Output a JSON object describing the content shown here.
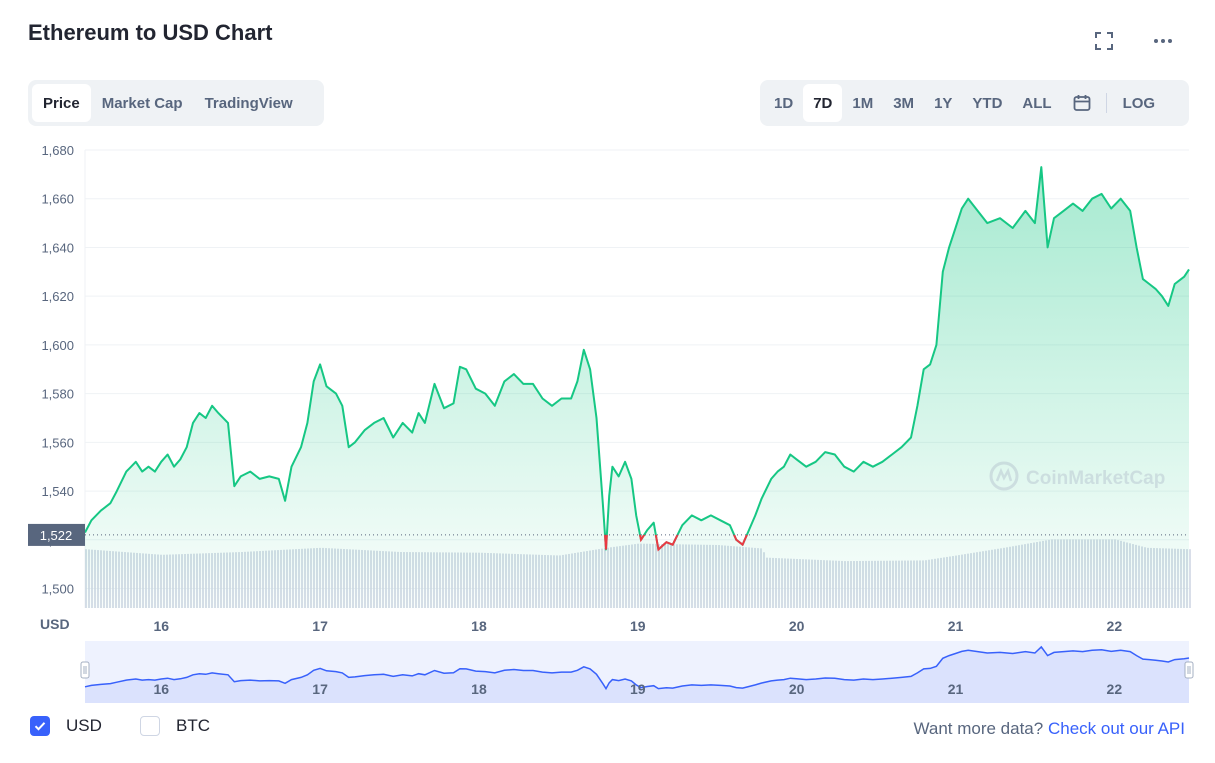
{
  "header": {
    "title": "Ethereum to USD Chart",
    "fullscreen_icon": "fullscreen-icon",
    "more_icon": "more-icon"
  },
  "tabs": [
    {
      "label": "Price",
      "active": true
    },
    {
      "label": "Market Cap",
      "active": false
    },
    {
      "label": "TradingView",
      "active": false
    }
  ],
  "ranges": [
    {
      "label": "1D",
      "active": false
    },
    {
      "label": "7D",
      "active": true
    },
    {
      "label": "1M",
      "active": false
    },
    {
      "label": "3M",
      "active": false
    },
    {
      "label": "1Y",
      "active": false
    },
    {
      "label": "YTD",
      "active": false
    },
    {
      "label": "ALL",
      "active": false
    }
  ],
  "calendar_icon": "calendar-icon",
  "log_label": "LOG",
  "currency": {
    "usd": {
      "label": "USD",
      "checked": true
    },
    "btc": {
      "label": "BTC",
      "checked": false
    }
  },
  "footer": {
    "text": "Want more data?",
    "link": "Check out our API"
  },
  "watermark": "CoinMarketCap",
  "colors": {
    "up": "#16c784",
    "down": "#ea3943",
    "accent": "#3861fb",
    "nav_line": "#3861fb"
  },
  "chart_data": {
    "type": "line",
    "xlabel": "",
    "ylabel": "USD",
    "x_ticks": [
      "16",
      "17",
      "18",
      "19",
      "20",
      "21",
      "22"
    ],
    "x_tick_positions": [
      16,
      17,
      18,
      19,
      20,
      21,
      22
    ],
    "x_range": [
      15.52,
      22.47
    ],
    "y_ticks": [
      1500,
      1520,
      1540,
      1560,
      1580,
      1600,
      1620,
      1640,
      1660,
      1680
    ],
    "y_range": [
      1492,
      1680
    ],
    "reference_price": 1522,
    "reference_label": "1,522",
    "grid": true,
    "series": [
      {
        "values": [
          [
            15.52,
            1523
          ],
          [
            15.56,
            1528
          ],
          [
            15.62,
            1532
          ],
          [
            15.68,
            1535
          ],
          [
            15.72,
            1540
          ],
          [
            15.78,
            1548
          ],
          [
            15.84,
            1552
          ],
          [
            15.88,
            1548
          ],
          [
            15.92,
            1550
          ],
          [
            15.96,
            1548
          ],
          [
            16.0,
            1552
          ],
          [
            16.04,
            1555
          ],
          [
            16.08,
            1550
          ],
          [
            16.12,
            1553
          ],
          [
            16.16,
            1558
          ],
          [
            16.2,
            1568
          ],
          [
            16.24,
            1572
          ],
          [
            16.28,
            1570
          ],
          [
            16.32,
            1575
          ],
          [
            16.36,
            1572
          ],
          [
            16.42,
            1568
          ],
          [
            16.46,
            1542
          ],
          [
            16.5,
            1546
          ],
          [
            16.56,
            1548
          ],
          [
            16.62,
            1545
          ],
          [
            16.68,
            1546
          ],
          [
            16.74,
            1545
          ],
          [
            16.78,
            1536
          ],
          [
            16.82,
            1550
          ],
          [
            16.88,
            1558
          ],
          [
            16.92,
            1568
          ],
          [
            16.96,
            1585
          ],
          [
            17.0,
            1592
          ],
          [
            17.04,
            1583
          ],
          [
            17.1,
            1580
          ],
          [
            17.14,
            1575
          ],
          [
            17.18,
            1558
          ],
          [
            17.22,
            1560
          ],
          [
            17.28,
            1565
          ],
          [
            17.34,
            1568
          ],
          [
            17.4,
            1570
          ],
          [
            17.46,
            1562
          ],
          [
            17.52,
            1568
          ],
          [
            17.58,
            1564
          ],
          [
            17.62,
            1572
          ],
          [
            17.66,
            1568
          ],
          [
            17.72,
            1584
          ],
          [
            17.78,
            1574
          ],
          [
            17.84,
            1576
          ],
          [
            17.88,
            1591
          ],
          [
            17.92,
            1590
          ],
          [
            17.98,
            1582
          ],
          [
            18.04,
            1580
          ],
          [
            18.1,
            1575
          ],
          [
            18.16,
            1585
          ],
          [
            18.22,
            1588
          ],
          [
            18.28,
            1584
          ],
          [
            18.34,
            1584
          ],
          [
            18.4,
            1578
          ],
          [
            18.46,
            1575
          ],
          [
            18.52,
            1578
          ],
          [
            18.58,
            1578
          ],
          [
            18.62,
            1585
          ],
          [
            18.66,
            1598
          ],
          [
            18.7,
            1590
          ],
          [
            18.74,
            1570
          ],
          [
            18.78,
            1535
          ],
          [
            18.8,
            1516
          ],
          [
            18.82,
            1538
          ],
          [
            18.84,
            1550
          ],
          [
            18.88,
            1546
          ],
          [
            18.92,
            1552
          ],
          [
            18.96,
            1545
          ],
          [
            18.99,
            1530
          ],
          [
            19.02,
            1520
          ],
          [
            19.06,
            1524
          ],
          [
            19.1,
            1527
          ],
          [
            19.13,
            1516
          ],
          [
            19.18,
            1519
          ],
          [
            19.22,
            1518
          ],
          [
            19.28,
            1526
          ],
          [
            19.34,
            1530
          ],
          [
            19.4,
            1528
          ],
          [
            19.46,
            1530
          ],
          [
            19.52,
            1528
          ],
          [
            19.58,
            1526
          ],
          [
            19.62,
            1520
          ],
          [
            19.66,
            1518
          ],
          [
            19.7,
            1524
          ],
          [
            19.74,
            1530
          ],
          [
            19.78,
            1537
          ],
          [
            19.84,
            1545
          ],
          [
            19.88,
            1548
          ],
          [
            19.92,
            1550
          ],
          [
            19.96,
            1555
          ],
          [
            20.0,
            1553
          ],
          [
            20.06,
            1550
          ],
          [
            20.12,
            1552
          ],
          [
            20.18,
            1556
          ],
          [
            20.24,
            1555
          ],
          [
            20.3,
            1550
          ],
          [
            20.36,
            1548
          ],
          [
            20.42,
            1552
          ],
          [
            20.48,
            1550
          ],
          [
            20.54,
            1552
          ],
          [
            20.6,
            1555
          ],
          [
            20.66,
            1558
          ],
          [
            20.72,
            1562
          ],
          [
            20.76,
            1575
          ],
          [
            20.8,
            1590
          ],
          [
            20.84,
            1592
          ],
          [
            20.88,
            1600
          ],
          [
            20.92,
            1630
          ],
          [
            20.96,
            1640
          ],
          [
            21.0,
            1648
          ],
          [
            21.04,
            1656
          ],
          [
            21.08,
            1660
          ],
          [
            21.14,
            1655
          ],
          [
            21.2,
            1650
          ],
          [
            21.28,
            1652
          ],
          [
            21.36,
            1648
          ],
          [
            21.44,
            1655
          ],
          [
            21.5,
            1650
          ],
          [
            21.54,
            1673
          ],
          [
            21.58,
            1640
          ],
          [
            21.62,
            1652
          ],
          [
            21.68,
            1655
          ],
          [
            21.74,
            1658
          ],
          [
            21.8,
            1655
          ],
          [
            21.86,
            1660
          ],
          [
            21.92,
            1662
          ],
          [
            21.98,
            1656
          ],
          [
            22.04,
            1660
          ],
          [
            22.1,
            1655
          ],
          [
            22.14,
            1640
          ],
          [
            22.18,
            1627
          ],
          [
            22.22,
            1625
          ],
          [
            22.26,
            1623
          ],
          [
            22.3,
            1620
          ],
          [
            22.34,
            1616
          ],
          [
            22.38,
            1625
          ],
          [
            22.44,
            1628
          ],
          [
            22.47,
            1631
          ]
        ]
      }
    ],
    "volume": [
      [
        15.52,
        0.84
      ],
      [
        16.0,
        0.76
      ],
      [
        16.5,
        0.8
      ],
      [
        17.0,
        0.86
      ],
      [
        17.5,
        0.8
      ],
      [
        18.0,
        0.79
      ],
      [
        18.5,
        0.75
      ],
      [
        18.8,
        0.86
      ],
      [
        19.0,
        0.92
      ],
      [
        19.5,
        0.9
      ],
      [
        19.78,
        0.85
      ],
      [
        19.8,
        0.72
      ],
      [
        20.3,
        0.67
      ],
      [
        20.8,
        0.68
      ],
      [
        21.0,
        0.75
      ],
      [
        21.3,
        0.86
      ],
      [
        21.6,
        0.98
      ],
      [
        22.0,
        0.98
      ],
      [
        22.2,
        0.86
      ],
      [
        22.47,
        0.84
      ]
    ]
  }
}
